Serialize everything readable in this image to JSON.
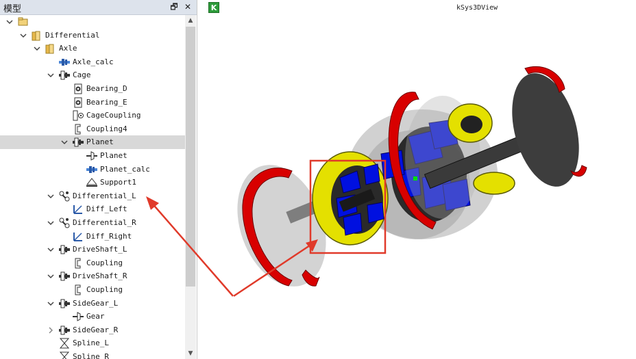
{
  "panel": {
    "title": "模型",
    "float_btn": "🗗",
    "close_btn": "✕"
  },
  "tree": [
    {
      "label": "",
      "icon": "folder-open-icon",
      "indent": 0,
      "chevron": "down",
      "selected": false
    },
    {
      "label": "Differential",
      "icon": "folder-icon",
      "indent": 1,
      "chevron": "down",
      "selected": false
    },
    {
      "label": "Axle",
      "icon": "folder-icon",
      "indent": 2,
      "chevron": "down",
      "selected": false
    },
    {
      "label": "Axle_calc",
      "icon": "shaft-calc-icon",
      "indent": 3,
      "chevron": "none",
      "selected": false
    },
    {
      "label": "Cage",
      "icon": "assembly-icon",
      "indent": 3,
      "chevron": "down",
      "selected": false
    },
    {
      "label": "Bearing_D",
      "icon": "bearing-icon",
      "indent": 4,
      "chevron": "none",
      "selected": false
    },
    {
      "label": "Bearing_E",
      "icon": "bearing-icon",
      "indent": 4,
      "chevron": "none",
      "selected": false
    },
    {
      "label": "CageCoupling",
      "icon": "coupling-gear-icon",
      "indent": 4,
      "chevron": "none",
      "selected": false
    },
    {
      "label": "Coupling4",
      "icon": "coupling-icon",
      "indent": 4,
      "chevron": "none",
      "selected": false
    },
    {
      "label": "Planet",
      "icon": "assembly-icon",
      "indent": 4,
      "chevron": "down",
      "selected": true
    },
    {
      "label": "Planet",
      "icon": "gear-icon",
      "indent": 5,
      "chevron": "none",
      "selected": false
    },
    {
      "label": "Planet_calc",
      "icon": "shaft-calc-icon",
      "indent": 5,
      "chevron": "none",
      "selected": false
    },
    {
      "label": "Support1",
      "icon": "support-icon",
      "indent": 5,
      "chevron": "none",
      "selected": false
    },
    {
      "label": "Differential_L",
      "icon": "gear-pair-icon",
      "indent": 3,
      "chevron": "down",
      "selected": false
    },
    {
      "label": "Diff_Left",
      "icon": "diff-icon",
      "indent": 4,
      "chevron": "none",
      "selected": false
    },
    {
      "label": "Differential_R",
      "icon": "gear-pair-icon",
      "indent": 3,
      "chevron": "down",
      "selected": false
    },
    {
      "label": "Diff_Right",
      "icon": "diff-icon",
      "indent": 4,
      "chevron": "none",
      "selected": false
    },
    {
      "label": "DriveShaft_L",
      "icon": "assembly-icon",
      "indent": 3,
      "chevron": "down",
      "selected": false
    },
    {
      "label": "Coupling",
      "icon": "coupling-icon",
      "indent": 4,
      "chevron": "none",
      "selected": false
    },
    {
      "label": "DriveShaft_R",
      "icon": "assembly-icon",
      "indent": 3,
      "chevron": "down",
      "selected": false
    },
    {
      "label": "Coupling",
      "icon": "coupling-icon",
      "indent": 4,
      "chevron": "none",
      "selected": false
    },
    {
      "label": "SideGear_L",
      "icon": "assembly-icon",
      "indent": 3,
      "chevron": "down",
      "selected": false
    },
    {
      "label": "Gear",
      "icon": "gear-icon",
      "indent": 4,
      "chevron": "none",
      "selected": false
    },
    {
      "label": "SideGear_R",
      "icon": "assembly-icon",
      "indent": 3,
      "chevron": "right",
      "selected": false
    },
    {
      "label": "Spline_L",
      "icon": "spline-icon",
      "indent": 3,
      "chevron": "none",
      "selected": false
    },
    {
      "label": "Spline_R",
      "icon": "spline-icon",
      "indent": 3,
      "chevron": "none",
      "selected": false
    }
  ],
  "scrollbar": {
    "up": "▲",
    "down": "▼"
  },
  "view": {
    "app_icon": "K",
    "title": "kSys3DView"
  },
  "colors": {
    "highlight": "#e03a2a",
    "gear_blue": "#0010e0",
    "ring_yellow": "#e4e000",
    "rim_red": "#d80000",
    "selected_row": "#d8d8d8"
  }
}
